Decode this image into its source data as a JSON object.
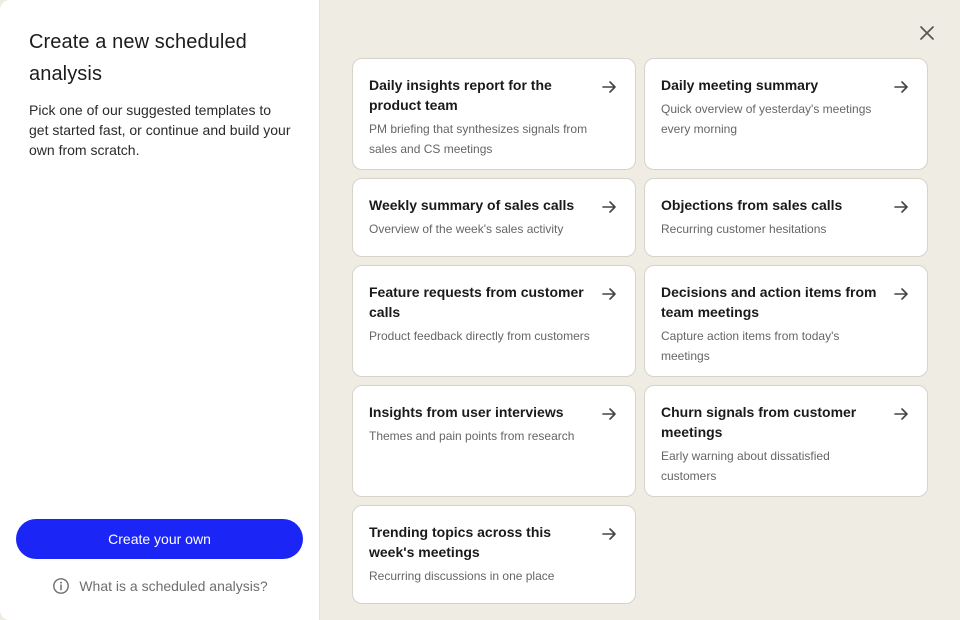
{
  "left": {
    "title": "Create a new scheduled analysis",
    "subtitle": "Pick one of our suggested templates to get started fast, or continue and build your own from scratch.",
    "create_button": "Create your own",
    "help_link": "What is a scheduled analysis?"
  },
  "templates": [
    {
      "title": "Daily insights report for the product team",
      "description": "PM briefing that synthesizes signals from sales and CS meetings"
    },
    {
      "title": "Daily meeting summary",
      "description": "Quick overview of yesterday's meetings every morning"
    },
    {
      "title": "Weekly summary of sales calls",
      "description": "Overview of the week's sales activity"
    },
    {
      "title": "Objections from sales calls",
      "description": "Recurring customer hesitations"
    },
    {
      "title": "Feature requests from customer calls",
      "description": "Product feedback directly from customers"
    },
    {
      "title": "Decisions and action items from team meetings",
      "description": "Capture action items from today's meetings"
    },
    {
      "title": "Insights from user interviews",
      "description": "Themes and pain points from research"
    },
    {
      "title": "Churn signals from customer meetings",
      "description": "Early warning about dissatisfied customers"
    },
    {
      "title": "Trending topics across this week's meetings",
      "description": "Recurring discussions in one place"
    }
  ],
  "icons": {
    "close": "close-icon",
    "arrow": "arrow-right-icon",
    "info": "info-icon"
  },
  "colors": {
    "accent": "#1b25f5",
    "panel_bg": "#efece4"
  }
}
